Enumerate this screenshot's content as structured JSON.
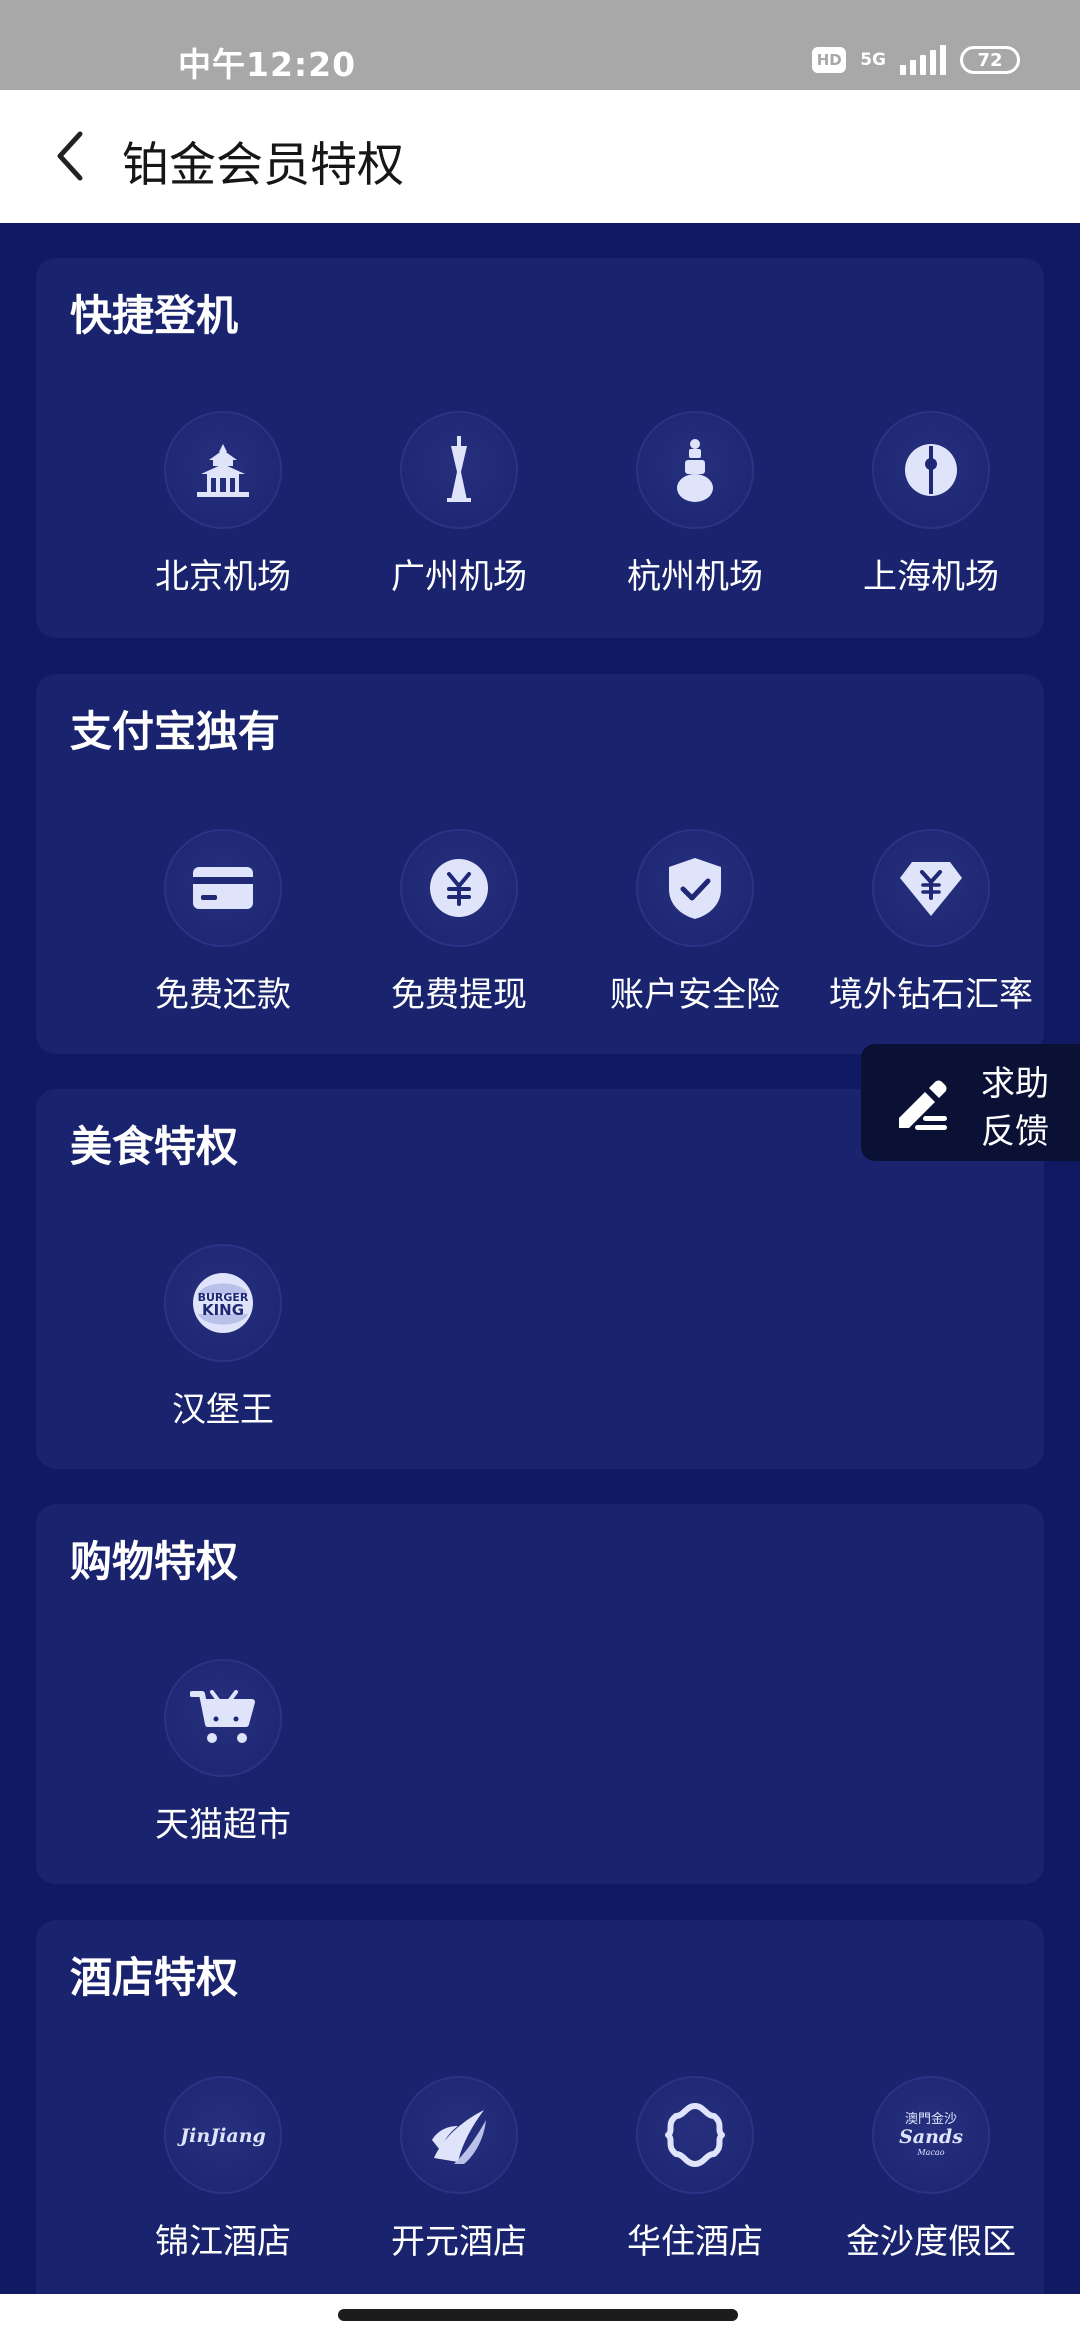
{
  "status_bar": {
    "time": "中午12:20",
    "hd": "HD",
    "network": "5G",
    "battery": "72"
  },
  "header": {
    "title": "铂金会员特权"
  },
  "sections": [
    {
      "title": "快捷登机",
      "items": [
        {
          "label": "北京机场",
          "icon": "beijing-temple-icon"
        },
        {
          "label": "广州机场",
          "icon": "canton-tower-icon"
        },
        {
          "label": "杭州机场",
          "icon": "hangzhou-pagoda-icon"
        },
        {
          "label": "上海机场",
          "icon": "pearl-tower-icon"
        }
      ]
    },
    {
      "title": "支付宝独有",
      "items": [
        {
          "label": "免费还款",
          "icon": "credit-card-icon"
        },
        {
          "label": "免费提现",
          "icon": "yuan-coin-icon"
        },
        {
          "label": "账户安全险",
          "icon": "shield-check-icon"
        },
        {
          "label": "境外钻石汇率",
          "icon": "diamond-yuan-icon"
        }
      ]
    },
    {
      "title": "美食特权",
      "items": [
        {
          "label": "汉堡王",
          "icon": "burger-king-logo",
          "logo_text_1": "BURGER",
          "logo_text_2": "KING"
        }
      ]
    },
    {
      "title": "购物特权",
      "items": [
        {
          "label": "天猫超市",
          "icon": "shopping-cart-icon"
        }
      ]
    },
    {
      "title": "酒店特权",
      "items": [
        {
          "label": "锦江酒店",
          "icon": "jinjiang-logo",
          "logo_text": "JinJiang"
        },
        {
          "label": "开元酒店",
          "icon": "kaiyuan-logo"
        },
        {
          "label": "华住酒店",
          "icon": "huazhu-logo"
        },
        {
          "label": "金沙度假区",
          "icon": "sands-logo",
          "logo_text_1": "澳門金沙",
          "logo_text_2": "Sands",
          "logo_text_3": "Macao"
        }
      ]
    }
  ],
  "help": {
    "line1": "求助",
    "line2": "反馈",
    "icon": "edit-pen-icon"
  },
  "colors": {
    "page_background": "#101a63",
    "card_background": "#1a246e",
    "icon_fill": "#dfe4fb",
    "header_background": "#ffffff",
    "status_bar": "#a8a8a8"
  }
}
